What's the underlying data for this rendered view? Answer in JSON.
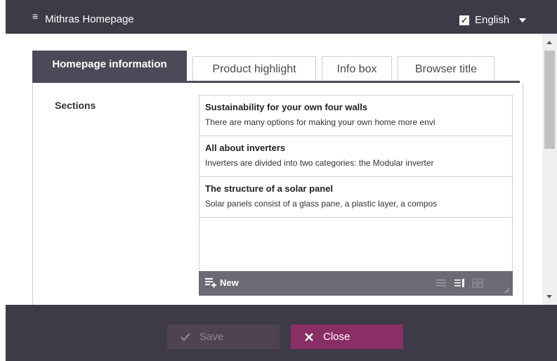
{
  "window": {
    "title": "Mithras Homepage",
    "menu_icon": "hamburger-icon",
    "language": "English",
    "language_checked": true
  },
  "tabs": [
    {
      "label": "Homepage information",
      "active": true
    },
    {
      "label": "Product highlight",
      "active": false
    },
    {
      "label": "Info box",
      "active": false
    },
    {
      "label": "Browser title",
      "active": false
    }
  ],
  "sections": {
    "label": "Sections",
    "items": [
      {
        "title": "Sustainability for your own four walls",
        "description": "There are many options for making your own home more envi"
      },
      {
        "title": "All about inverters",
        "description": "Inverters are divided into two categories: the Modular inverter"
      },
      {
        "title": "The structure of a solar panel",
        "description": "Solar panels consist of a glass pane, a plastic layer, a compos"
      }
    ],
    "toolbar": {
      "new_label": "New",
      "view_icons": [
        "list-view-icon",
        "detail-view-icon",
        "grid-view-icon"
      ]
    }
  },
  "footer": {
    "save_label": "Save",
    "close_label": "Close"
  },
  "colors": {
    "dark": "#3c3b47",
    "tab_active": "#4a4a58",
    "close_accent": "#8a2e66"
  }
}
